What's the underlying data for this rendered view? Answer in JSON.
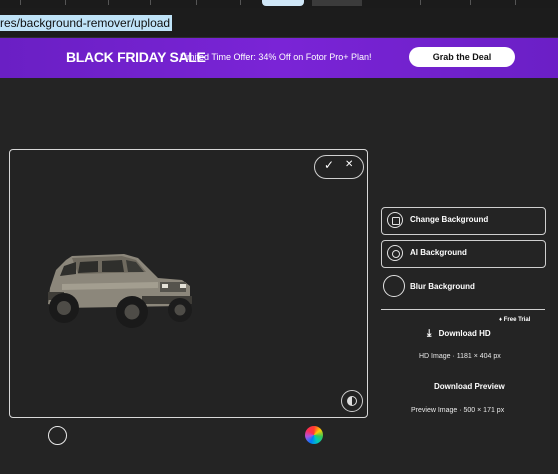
{
  "browser": {
    "url": "res/background-remover/upload"
  },
  "banner": {
    "sale_label": "BLACK FRIDAY SALE",
    "offer_text": "Limited Time Offer: 34% Off on Fotor Pro+ Plan!",
    "cta_label": "Grab the Deal",
    "bg_color": "#7a24d6"
  },
  "canvas": {
    "confirm_icon": "check-icon",
    "cancel_icon": "close-icon",
    "check_glyph": "✓",
    "close_glyph": "✕",
    "compare_icon": "compare-icon",
    "image_subject": "car-image"
  },
  "bottom_tools": {
    "transparent_icon": "transparent-circle-icon",
    "color_icon": "color-wheel-icon"
  },
  "panel": {
    "options": [
      {
        "label": "Change Background",
        "icon": "change-background-icon"
      },
      {
        "label": "AI Background",
        "icon": "ai-background-icon"
      },
      {
        "label": "Blur Background",
        "icon": "blur-background-icon"
      }
    ],
    "free_trial": "Free Trial",
    "download_hd": "Download HD",
    "hd_info": "HD Image · 1181 × 404 px",
    "download_preview": "Download Preview",
    "preview_info": "Preview Image · 500 × 171 px"
  }
}
